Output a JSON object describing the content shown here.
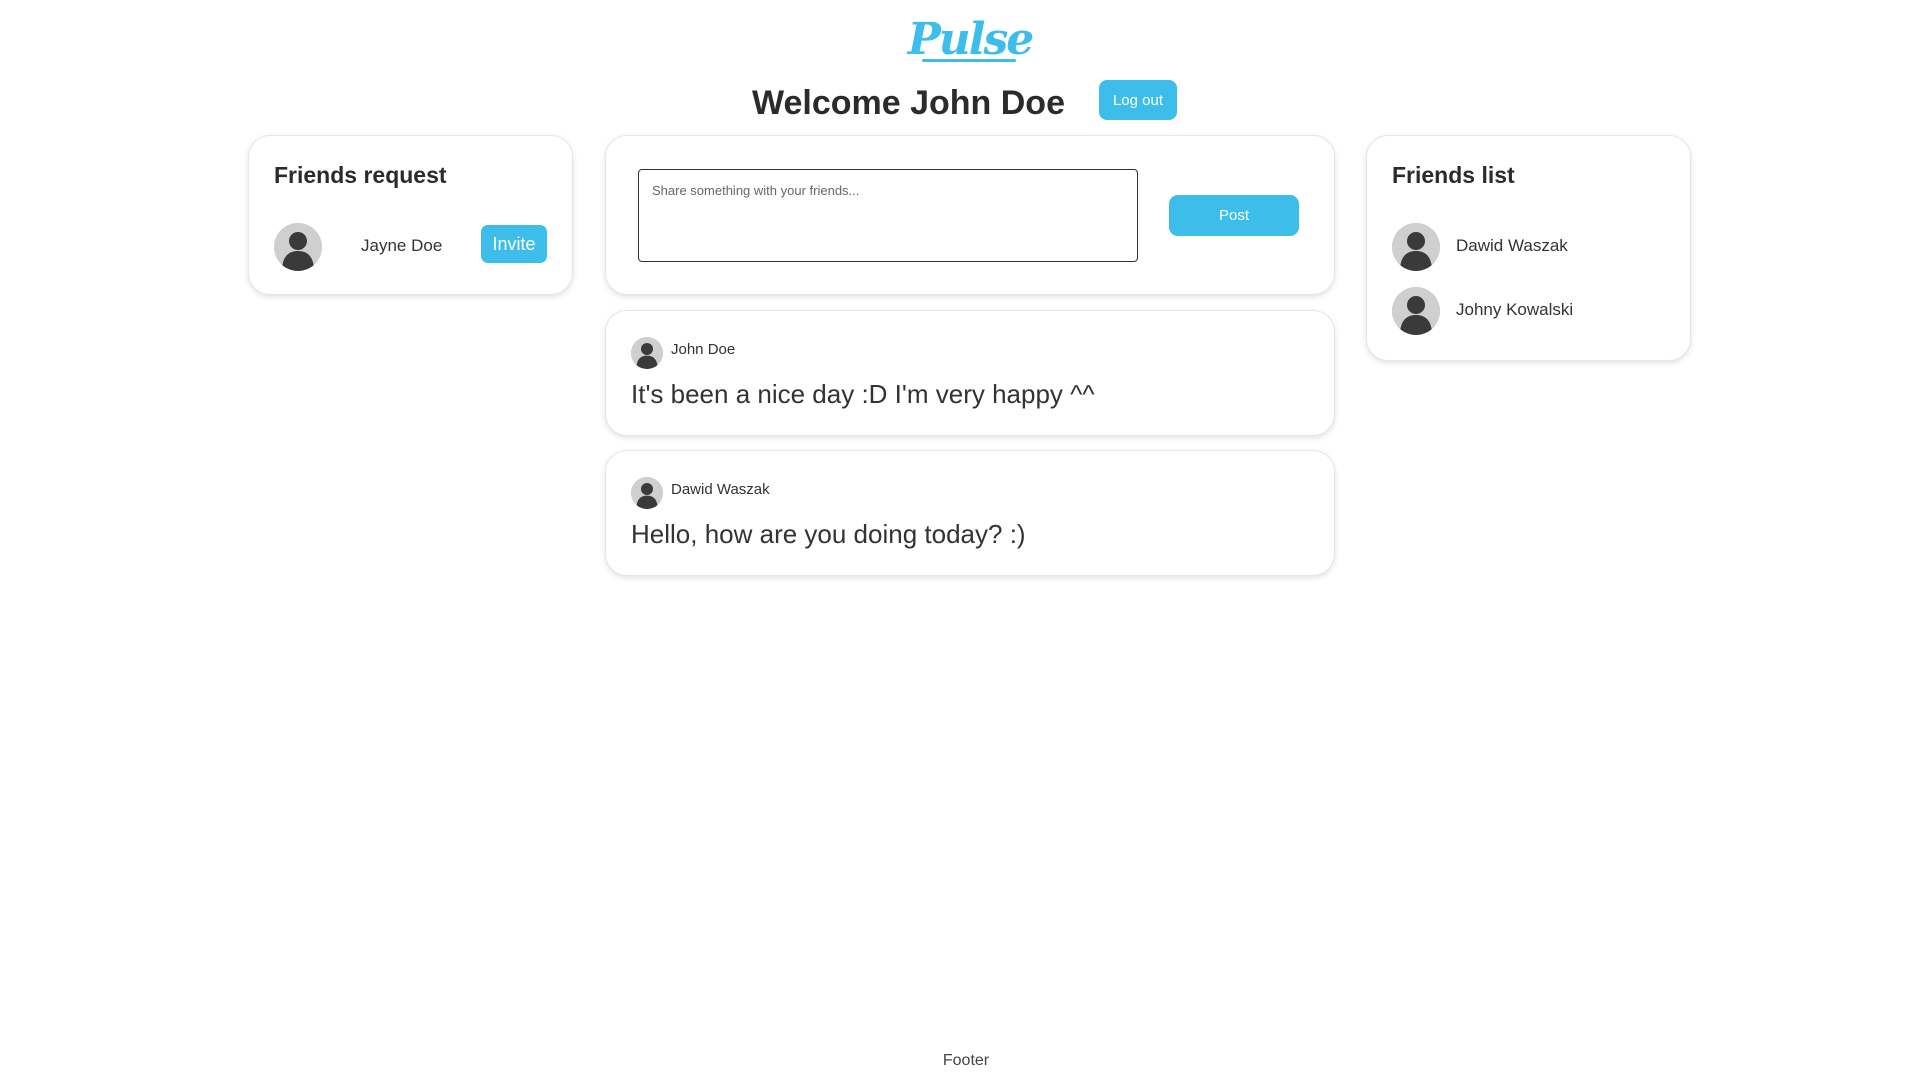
{
  "app": {
    "logo_text": "Pulse",
    "welcome_text": "Welcome John Doe",
    "logout_label": "Log out",
    "accent_color": "#3dbde9"
  },
  "friend_requests": {
    "title": "Friends request",
    "items": [
      {
        "name": "Jayne Doe",
        "action_label": "Invite"
      }
    ]
  },
  "composer": {
    "placeholder": "Share something with your friends...",
    "value": "",
    "post_label": "Post"
  },
  "feed": {
    "posts": [
      {
        "author": "John Doe",
        "text": "It's been a nice day :D I'm very happy ^^"
      },
      {
        "author": "Dawid Waszak",
        "text": "Hello, how are you doing today? :)"
      }
    ]
  },
  "friends_list": {
    "title": "Friends list",
    "items": [
      {
        "name": "Dawid Waszak"
      },
      {
        "name": "Johny Kowalski"
      }
    ]
  },
  "footer": {
    "text": "Footer"
  },
  "icons": {
    "avatar": "user-silhouette-icon"
  }
}
